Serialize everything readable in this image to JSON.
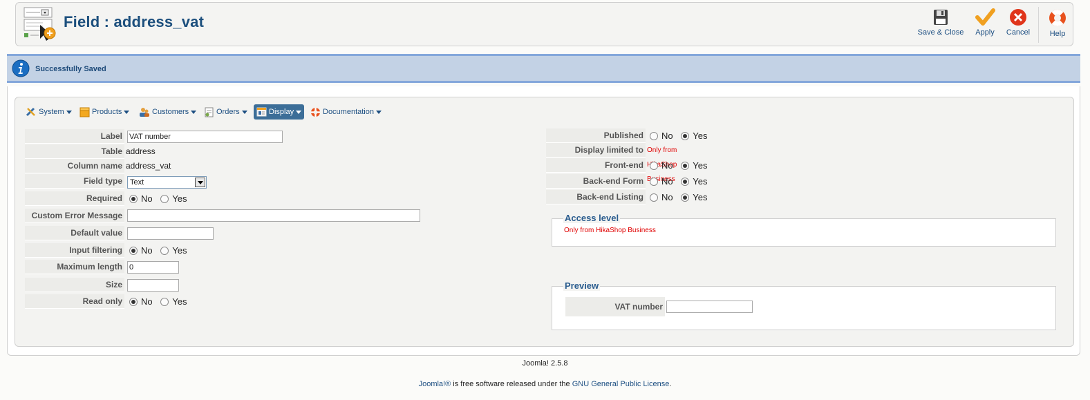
{
  "header": {
    "title": "Field : address_vat",
    "buttons": {
      "save_close": "Save & Close",
      "apply": "Apply",
      "cancel": "Cancel",
      "help": "Help"
    }
  },
  "message": {
    "text": "Successfully Saved"
  },
  "menu": {
    "items": [
      {
        "label": "System"
      },
      {
        "label": "Products"
      },
      {
        "label": "Customers"
      },
      {
        "label": "Orders"
      },
      {
        "label": "Display"
      },
      {
        "label": "Documentation"
      }
    ],
    "active": "Display"
  },
  "left_form": {
    "label": {
      "label": "Label",
      "value": "VAT number"
    },
    "table": {
      "label": "Table",
      "value": "address"
    },
    "column_name": {
      "label": "Column name",
      "value": "address_vat"
    },
    "field_type": {
      "label": "Field type",
      "value": "Text"
    },
    "required": {
      "label": "Required",
      "no": "No",
      "yes": "Yes",
      "selected": "No"
    },
    "custom_error": {
      "label": "Custom Error Message",
      "value": ""
    },
    "default_value": {
      "label": "Default value",
      "value": ""
    },
    "input_filtering": {
      "label": "Input filtering",
      "no": "No",
      "yes": "Yes",
      "selected": "No"
    },
    "max_length": {
      "label": "Maximum length",
      "value": "0"
    },
    "size": {
      "label": "Size",
      "value": ""
    },
    "read_only": {
      "label": "Read only",
      "no": "No",
      "yes": "Yes",
      "selected": "No"
    }
  },
  "right_form": {
    "published": {
      "label": "Published",
      "no": "No",
      "yes": "Yes",
      "selected": "Yes"
    },
    "display_limited": {
      "label": "Display limited to",
      "value": "Only from HikaShop Business"
    },
    "frontend": {
      "label": "Front-end",
      "no": "No",
      "yes": "Yes",
      "selected": "Yes"
    },
    "backend_form": {
      "label": "Back-end Form",
      "no": "No",
      "yes": "Yes",
      "selected": "Yes"
    },
    "backend_listing": {
      "label": "Back-end Listing",
      "no": "No",
      "yes": "Yes",
      "selected": "Yes"
    }
  },
  "access_level": {
    "legend": "Access level",
    "note": "Only from HikaShop Business"
  },
  "preview": {
    "legend": "Preview",
    "field_label": "VAT number",
    "field_value": ""
  },
  "footer": {
    "version": "Joomla! 2.5.8",
    "license_prefix": "Joomla!® is free software released under the ",
    "license_link": "GNU General Public License",
    "license_suffix": "."
  },
  "colors": {
    "title": "#1c4f7d",
    "link": "#1d4f82",
    "message_bg": "#c3d2e5",
    "active_menu": "#3c6e98",
    "note_red": "#e00000"
  }
}
